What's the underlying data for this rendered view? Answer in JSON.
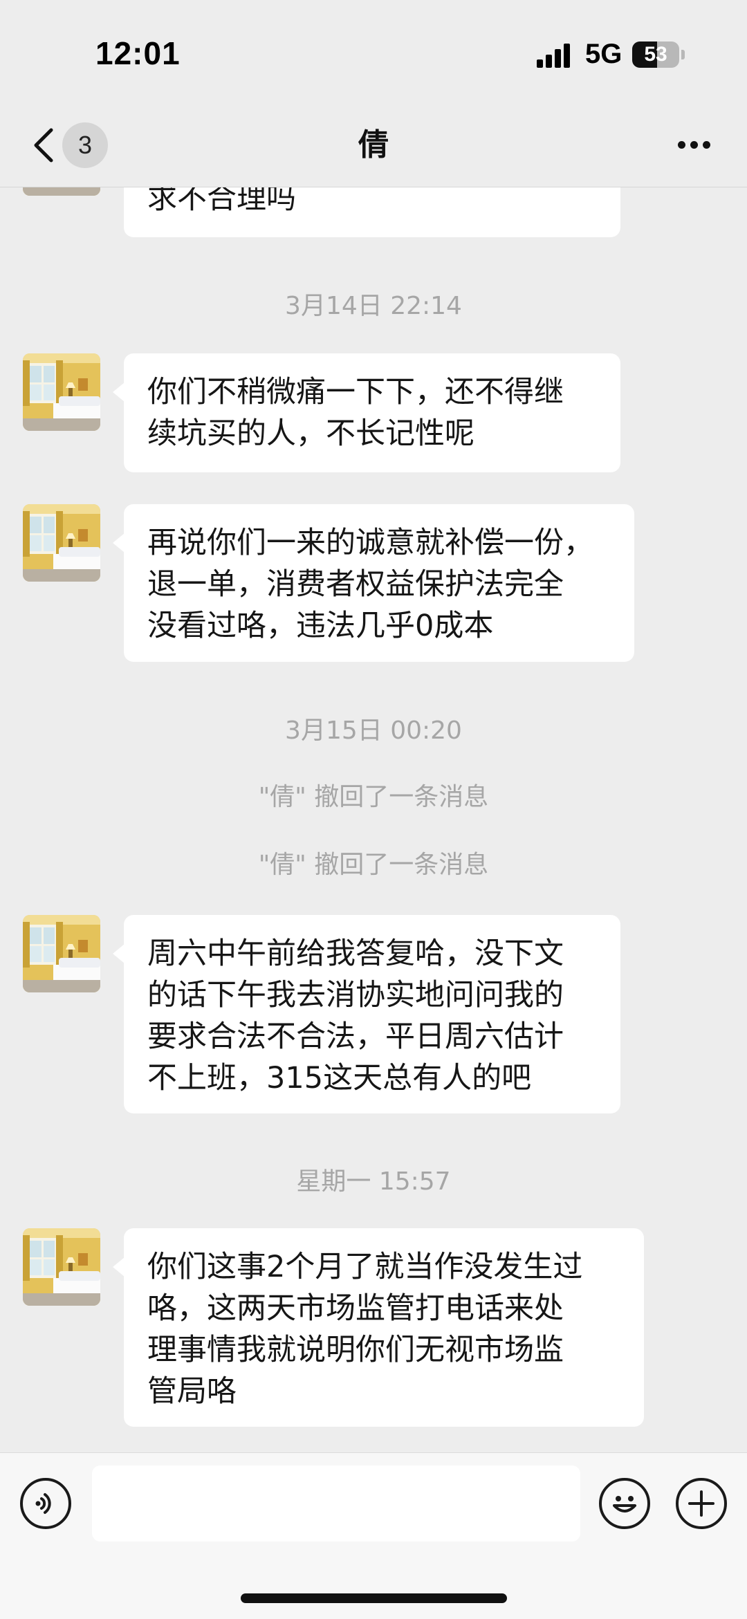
{
  "status_bar": {
    "time": "12:01",
    "network": "5G",
    "battery_level": "53",
    "battery_fraction": 0.53
  },
  "nav": {
    "unread_count": "3",
    "title": "倩",
    "back_icon": "chevron-left-icon",
    "more_icon": "ellipsis-icon"
  },
  "messages": [
    {
      "type": "text",
      "text": "求不合理吗"
    },
    {
      "type": "time",
      "text": "3月14日 22:14"
    },
    {
      "type": "text",
      "text": "你们不稍微痛一下下，还不得继\n续坑买的人，不长记性呢"
    },
    {
      "type": "text",
      "text": "再说你们一来的诚意就补偿一份，\n退一单，消费者权益保护法完全\n没看过咯，违法几乎0成本"
    },
    {
      "type": "time",
      "text": "3月15日 00:20"
    },
    {
      "type": "system",
      "text": "\"倩\" 撤回了一条消息"
    },
    {
      "type": "system",
      "text": "\"倩\" 撤回了一条消息"
    },
    {
      "type": "text",
      "text": "周六中午前给我答复哈，没下文\n的话下午我去消协实地问问我的\n要求合法不合法，平日周六估计\n不上班，315这天总有人的吧"
    },
    {
      "type": "time",
      "text": "星期一 15:57"
    },
    {
      "type": "text",
      "text": "你们这事2个月了就当作没发生过\n咯，这两天市场监管打电话来处\n理事情我就说明你们无视市场监\n管局咯"
    }
  ],
  "input_bar": {
    "voice_icon": "voice-icon",
    "placeholder": "",
    "emoji_icon": "emoji-icon",
    "add_icon": "plus-icon"
  },
  "colors": {
    "background": "#ededed",
    "bubble": "#ffffff",
    "meta_text": "#a6a6a6"
  }
}
